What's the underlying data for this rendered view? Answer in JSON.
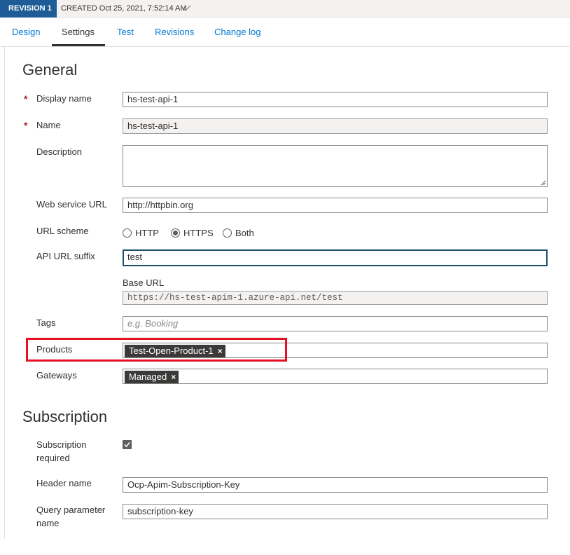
{
  "revision": {
    "badge": "REVISION 1",
    "created": "CREATED Oct 25, 2021, 7:52:14 AM"
  },
  "tabs": [
    {
      "label": "Design",
      "active": false
    },
    {
      "label": "Settings",
      "active": true
    },
    {
      "label": "Test",
      "active": false
    },
    {
      "label": "Revisions",
      "active": false
    },
    {
      "label": "Change log",
      "active": false
    }
  ],
  "general": {
    "title": "General",
    "display_name": {
      "label": "Display name",
      "value": "hs-test-api-1",
      "required_mark": "*"
    },
    "name": {
      "label": "Name",
      "value": "hs-test-api-1",
      "required_mark": "*"
    },
    "description": {
      "label": "Description",
      "value": ""
    },
    "web_service_url": {
      "label": "Web service URL",
      "value": "http://httpbin.org"
    },
    "url_scheme": {
      "label": "URL scheme",
      "options": [
        "HTTP",
        "HTTPS",
        "Both"
      ],
      "selected": "HTTPS"
    },
    "api_url_suffix": {
      "label": "API URL suffix",
      "value": "test"
    },
    "base_url": {
      "label": "Base URL",
      "value": "https://hs-test-apim-1.azure-api.net/test"
    },
    "tags": {
      "label": "Tags",
      "placeholder": "e.g. Booking"
    },
    "products": {
      "label": "Products",
      "tags": [
        "Test-Open-Product-1"
      ]
    },
    "gateways": {
      "label": "Gateways",
      "tags": [
        "Managed"
      ]
    },
    "tag_remove_glyph": "×"
  },
  "subscription": {
    "title": "Subscription",
    "required": {
      "label_line1": "Subscription",
      "label_line2": "required",
      "checked": true
    },
    "header_name": {
      "label": "Header name",
      "value": "Ocp-Apim-Subscription-Key"
    },
    "query_param": {
      "label_line1": "Query parameter",
      "label_line2": "name",
      "value": "subscription-key"
    }
  },
  "colors": {
    "brand": "#1d5c97",
    "link": "#0078d4",
    "highlight": "#e81123",
    "required": "#a4262c"
  }
}
